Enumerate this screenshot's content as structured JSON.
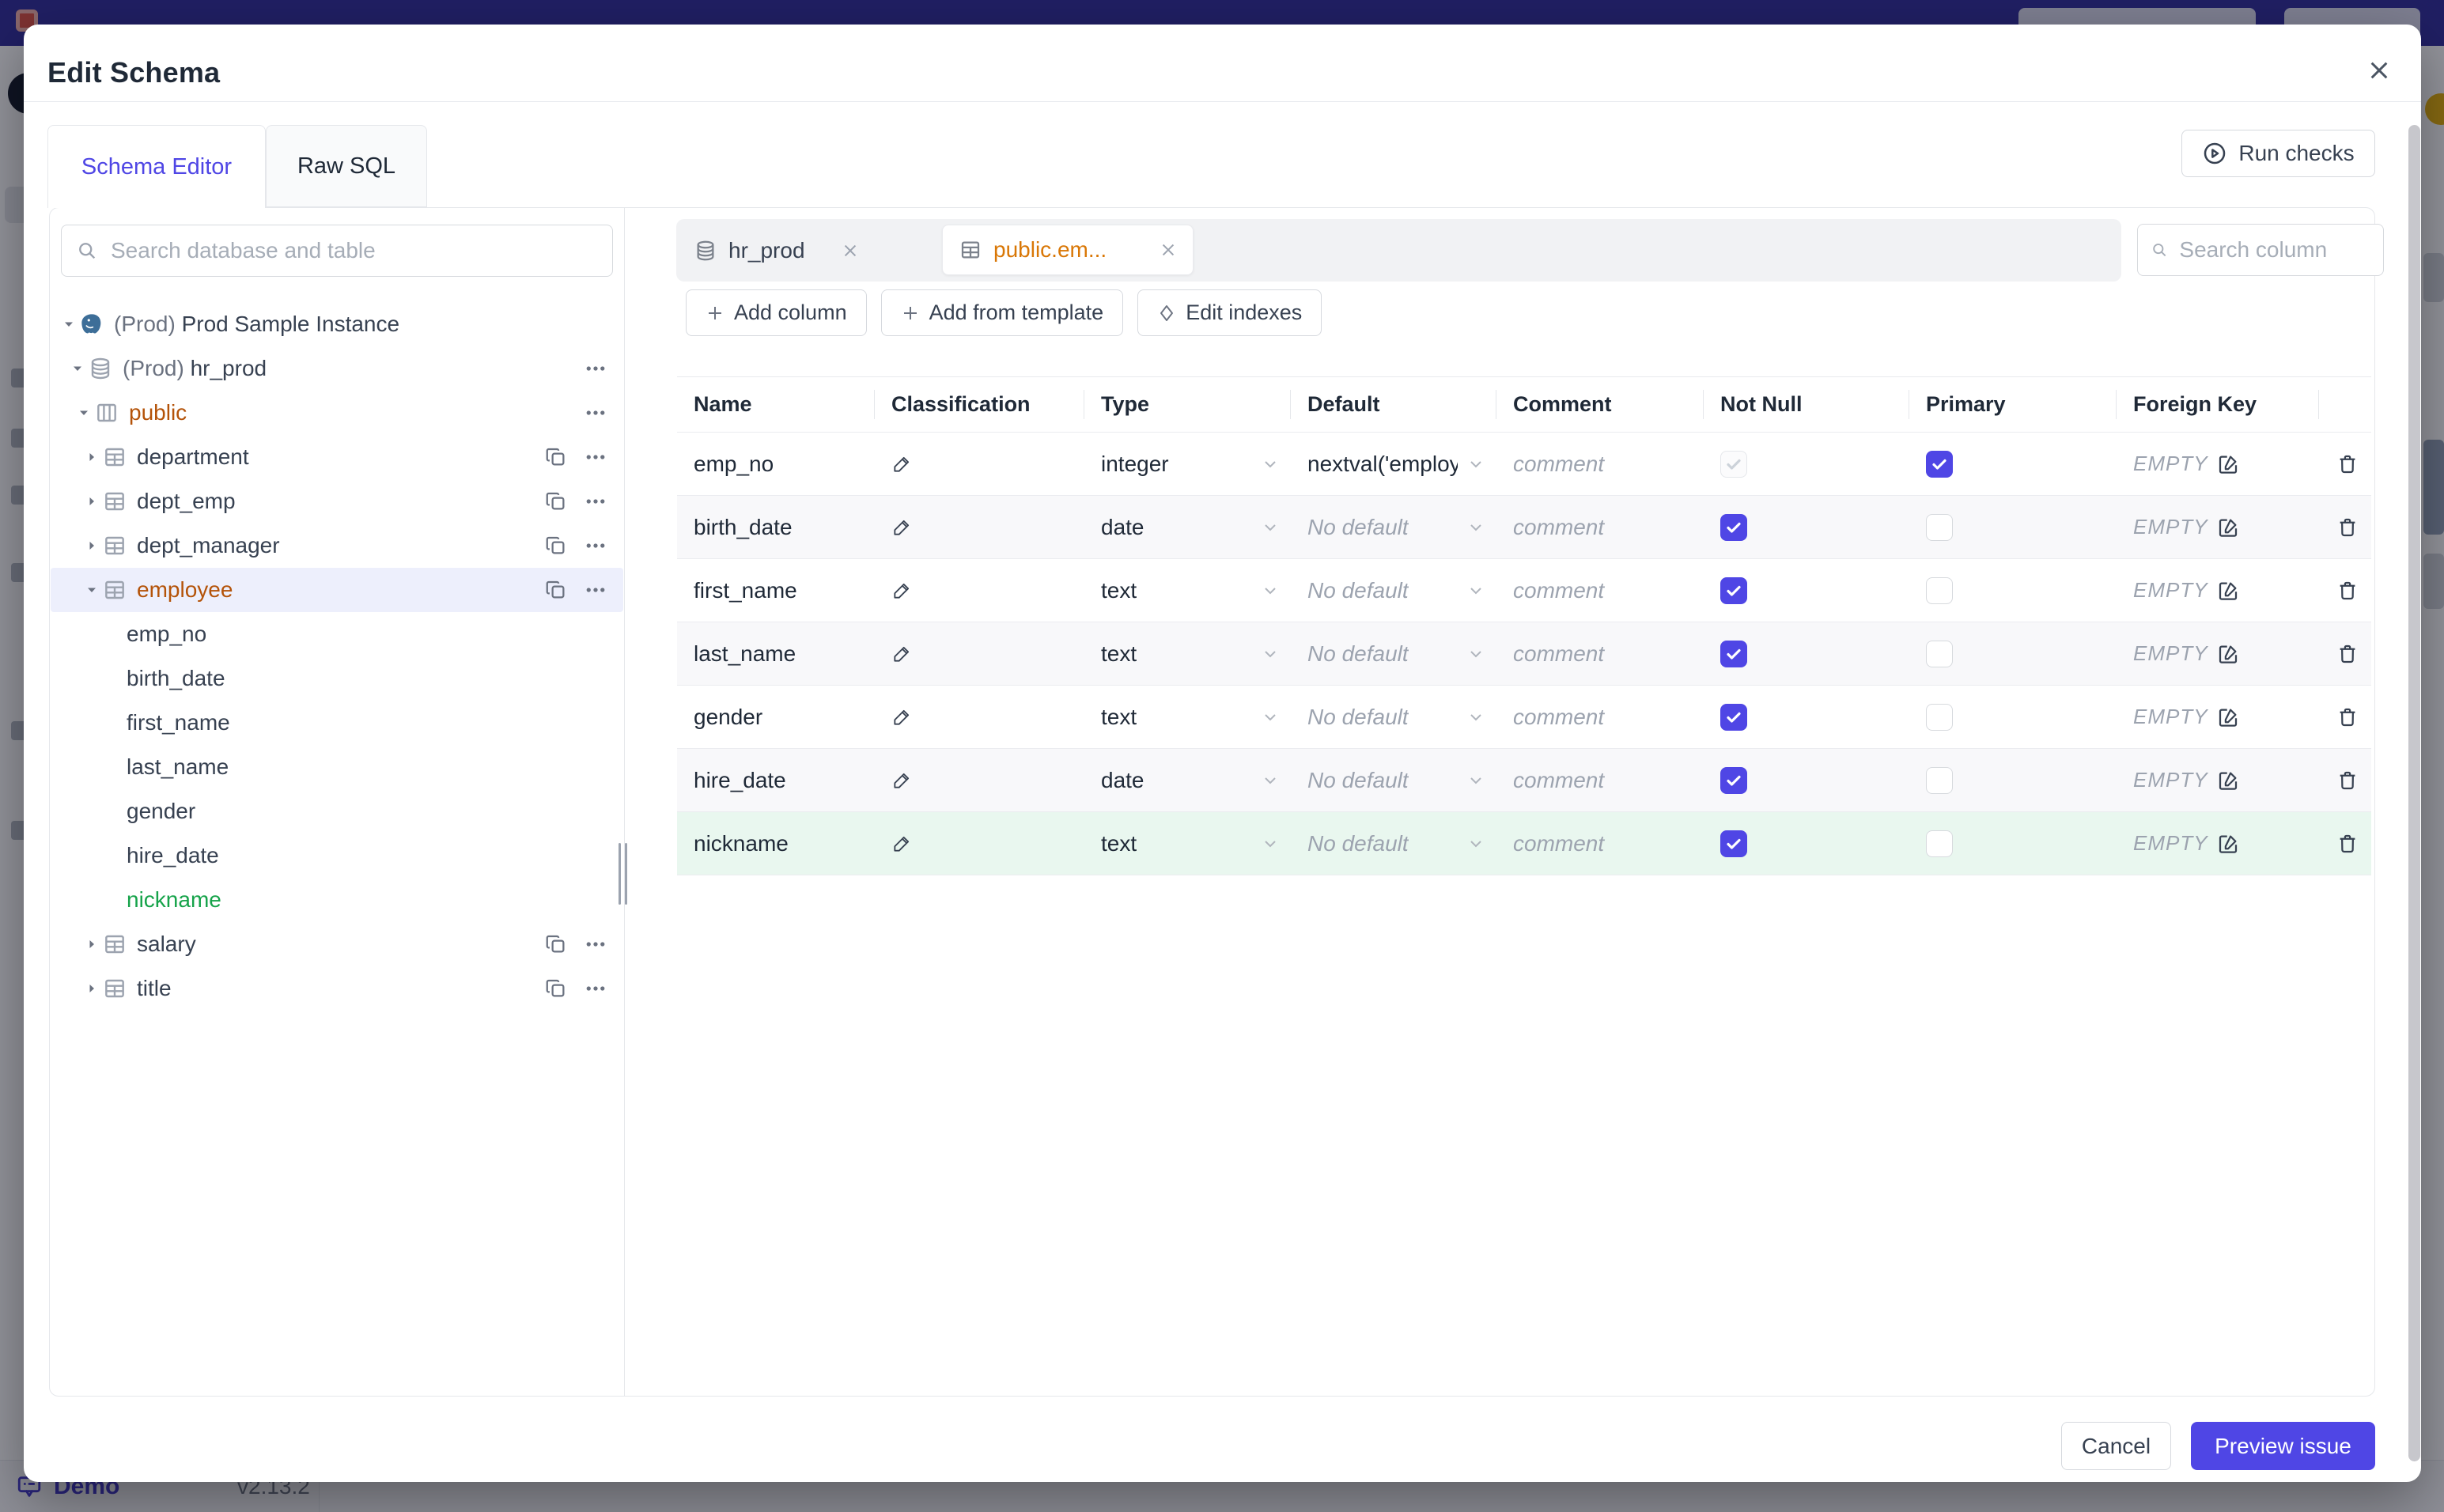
{
  "colors": {
    "accent": "#4f46e5",
    "modified": "#b45309",
    "added": "#16a34a",
    "header_bar": "#312c9c",
    "tab_active_text": "#d97706"
  },
  "backdrop": {
    "demo_label": "Demo",
    "version": "v2.13.2"
  },
  "modal": {
    "title": "Edit Schema",
    "tabs": [
      {
        "label": "Schema Editor",
        "active": true
      },
      {
        "label": "Raw SQL",
        "active": false
      }
    ],
    "run_checks_label": "Run checks",
    "sidebar": {
      "search_placeholder": "Search database and table",
      "tree": [
        {
          "type": "instance",
          "icon": "postgres-icon",
          "caret": "down",
          "prefix": "(Prod) ",
          "label": "Prod Sample Instance",
          "actions": []
        },
        {
          "type": "database",
          "icon": "database-icon",
          "caret": "down",
          "prefix": "(Prod) ",
          "label": "hr_prod",
          "actions": [
            "dots"
          ]
        },
        {
          "type": "schema",
          "icon": "schema-icon",
          "caret": "down",
          "prefix": "",
          "label": "public",
          "state": "modified",
          "actions": [
            "dots"
          ]
        },
        {
          "type": "table",
          "icon": "table-icon",
          "caret": "right",
          "prefix": "",
          "label": "department",
          "actions": [
            "copy",
            "dots"
          ]
        },
        {
          "type": "table",
          "icon": "table-icon",
          "caret": "right",
          "prefix": "",
          "label": "dept_emp",
          "actions": [
            "copy",
            "dots"
          ]
        },
        {
          "type": "table",
          "icon": "table-icon",
          "caret": "right",
          "prefix": "",
          "label": "dept_manager",
          "actions": [
            "copy",
            "dots"
          ]
        },
        {
          "type": "table",
          "icon": "table-icon",
          "caret": "down",
          "prefix": "",
          "label": "employee",
          "state": "modified",
          "selected": true,
          "actions": [
            "copy",
            "dots"
          ]
        },
        {
          "type": "column",
          "icon": null,
          "caret": null,
          "prefix": "",
          "label": "emp_no",
          "actions": []
        },
        {
          "type": "column",
          "icon": null,
          "caret": null,
          "prefix": "",
          "label": "birth_date",
          "actions": []
        },
        {
          "type": "column",
          "icon": null,
          "caret": null,
          "prefix": "",
          "label": "first_name",
          "actions": []
        },
        {
          "type": "column",
          "icon": null,
          "caret": null,
          "prefix": "",
          "label": "last_name",
          "actions": []
        },
        {
          "type": "column",
          "icon": null,
          "caret": null,
          "prefix": "",
          "label": "gender",
          "actions": []
        },
        {
          "type": "column",
          "icon": null,
          "caret": null,
          "prefix": "",
          "label": "hire_date",
          "actions": []
        },
        {
          "type": "column",
          "icon": null,
          "caret": null,
          "prefix": "",
          "label": "nickname",
          "state": "added",
          "actions": []
        },
        {
          "type": "table",
          "icon": "table-icon",
          "caret": "right",
          "prefix": "",
          "label": "salary",
          "actions": [
            "copy",
            "dots"
          ]
        },
        {
          "type": "table",
          "icon": "table-icon",
          "caret": "right",
          "prefix": "",
          "label": "title",
          "actions": [
            "copy",
            "dots"
          ]
        }
      ]
    },
    "editor": {
      "tabs": [
        {
          "label": "hr_prod",
          "icon": "database-icon",
          "active": false
        },
        {
          "label": "public.em...",
          "icon": "table-icon",
          "active": true,
          "modified": true
        }
      ],
      "search_placeholder": "Search column",
      "toolbar": [
        {
          "label": "Add column",
          "icon": "plus-icon"
        },
        {
          "label": "Add from template",
          "icon": "plus-icon"
        },
        {
          "label": "Edit indexes",
          "icon": "diamond-icon"
        }
      ],
      "table": {
        "columns": [
          "Name",
          "Classification",
          "Type",
          "Default",
          "Comment",
          "Not Null",
          "Primary",
          "Foreign Key"
        ],
        "comment_placeholder": "comment",
        "fk_empty_label": "EMPTY",
        "rows": [
          {
            "name": "emp_no",
            "type": "integer",
            "default": "nextval('employ",
            "default_set": true,
            "not_null": "disabled",
            "primary": true,
            "added": false
          },
          {
            "name": "birth_date",
            "type": "date",
            "default": "No default",
            "default_set": false,
            "not_null": "on",
            "primary": false,
            "added": false
          },
          {
            "name": "first_name",
            "type": "text",
            "default": "No default",
            "default_set": false,
            "not_null": "on",
            "primary": false,
            "added": false
          },
          {
            "name": "last_name",
            "type": "text",
            "default": "No default",
            "default_set": false,
            "not_null": "on",
            "primary": false,
            "added": false
          },
          {
            "name": "gender",
            "type": "text",
            "default": "No default",
            "default_set": false,
            "not_null": "on",
            "primary": false,
            "added": false
          },
          {
            "name": "hire_date",
            "type": "date",
            "default": "No default",
            "default_set": false,
            "not_null": "on",
            "primary": false,
            "added": false
          },
          {
            "name": "nickname",
            "type": "text",
            "default": "No default",
            "default_set": false,
            "not_null": "on",
            "primary": false,
            "added": true
          }
        ]
      }
    },
    "footer": {
      "cancel": "Cancel",
      "submit": "Preview issue"
    }
  }
}
